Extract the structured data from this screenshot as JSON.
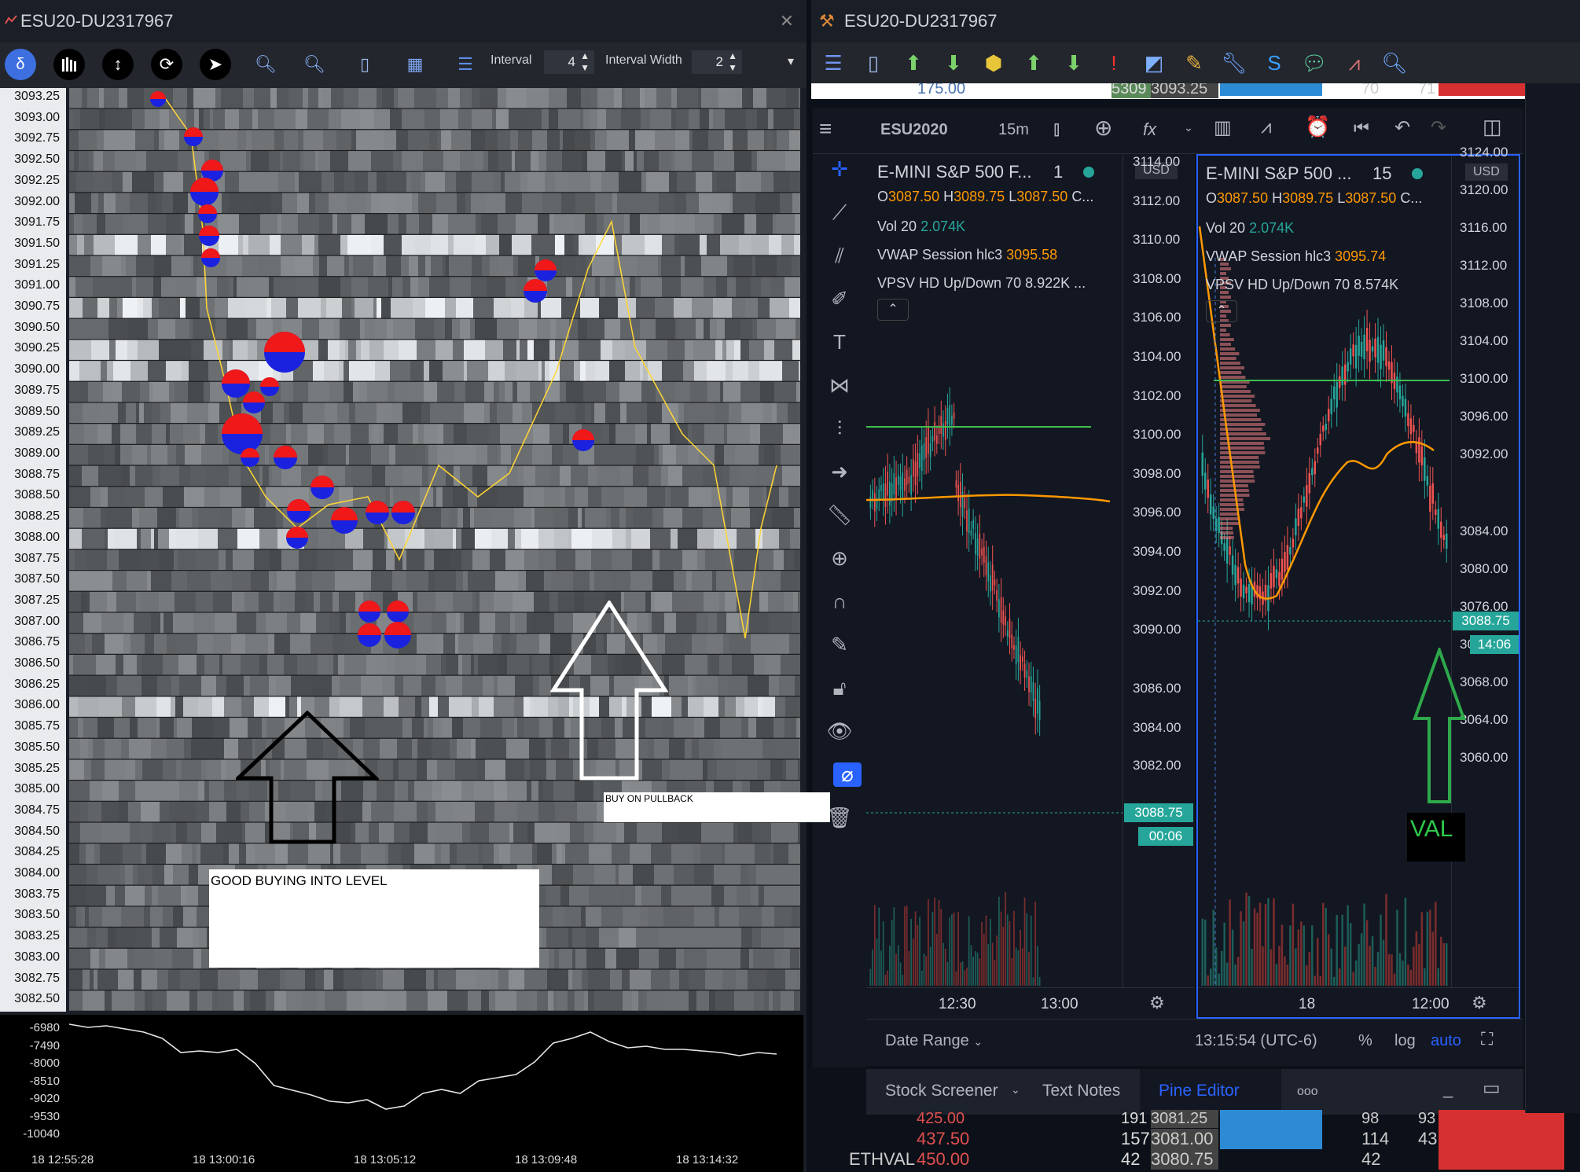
{
  "left_window": {
    "title": "ESU20-DU2317967",
    "close_glyph": "✕",
    "toolbar": {
      "interval_label": "Interval",
      "interval_value": "4",
      "interval_width_label": "Interval Width",
      "interval_width_value": "2",
      "overflow_glyph": "▾"
    },
    "price_ladder": [
      "3093.25",
      "3093.00",
      "3092.75",
      "3092.50",
      "3092.25",
      "3092.00",
      "3091.75",
      "3091.50",
      "3091.25",
      "3091.00",
      "3090.75",
      "3090.50",
      "3090.25",
      "3090.00",
      "3089.75",
      "3089.50",
      "3089.25",
      "3089.00",
      "3088.75",
      "3088.50",
      "3088.25",
      "3088.00",
      "3087.75",
      "3087.50",
      "3087.25",
      "3087.00",
      "3086.75",
      "3086.50",
      "3086.25",
      "3086.00",
      "3085.75",
      "3085.50",
      "3085.25",
      "3085.00",
      "3084.75",
      "3084.50",
      "3084.25",
      "3084.00",
      "3083.75",
      "3083.50",
      "3083.25",
      "3083.00",
      "3082.75",
      "3082.50"
    ],
    "annotations": {
      "good_buying": "GOOD BUYING INTO LEVEL",
      "buy_pullback": "BUY ON PULLBACK"
    },
    "delta_axis": [
      "-6980",
      "-7490",
      "-8000",
      "-8510",
      "-9020",
      "-9530",
      "-10040"
    ],
    "time_axis": [
      "18 12:55:28",
      "18 13:00:16",
      "18 13:05:12",
      "18 13:09:48",
      "18 13:14:32"
    ]
  },
  "right_window": {
    "title": "ESU20-DU2317967",
    "dom_top": {
      "price": "175.00",
      "vol": "5309",
      "level": "3093.25",
      "bid": "70",
      "ask": "71"
    },
    "tv_header": {
      "symbol": "ESU2020",
      "interval": "15m",
      "fx": "fx"
    },
    "pane1": {
      "name": "E-MINI S&P 500 F...",
      "interval": "1",
      "currency": "USD",
      "ohlc": {
        "o_label": "O",
        "o": "3087.50",
        "h_label": "H",
        "h": "3089.75",
        "l_label": "L",
        "l": "3087.50",
        "c_label": "C..."
      },
      "vol_label": "Vol 20",
      "vol_value": "2.074K",
      "vwap_label": "VWAP Session hlc3",
      "vwap_value": "3095.58",
      "vpsv_label": "VPSV HD Up/Down 70",
      "vpsv_value": "8.922K ...",
      "price_axis": [
        "3114.00",
        "3112.00",
        "3110.00",
        "3108.00",
        "3106.00",
        "3104.00",
        "3102.00",
        "3100.00",
        "3098.00",
        "3096.00",
        "3094.00",
        "3092.00",
        "3090.00",
        "3086.00",
        "3084.00",
        "3082.00"
      ],
      "last_price": "3088.75",
      "countdown": "00:06",
      "time_axis": [
        "12:30",
        "13:00"
      ]
    },
    "pane2": {
      "name": "E-MINI S&P 500 ...",
      "interval": "15",
      "currency": "USD",
      "ohlc": {
        "o_label": "O",
        "o": "3087.50",
        "h_label": "H",
        "h": "3089.75",
        "l_label": "L",
        "l": "3087.50",
        "c_label": "C..."
      },
      "vol_label": "Vol 20",
      "vol_value": "2.074K",
      "vwap_label": "VWAP Session hlc3",
      "vwap_value": "3095.74",
      "vpsv_label": "VPSV HD Up/Down 70",
      "vpsv_value": "8.574K",
      "price_axis": [
        "3124.00",
        "3120.00",
        "3116.00",
        "3112.00",
        "3108.00",
        "3104.00",
        "3100.00",
        "3096.00",
        "3092.00",
        "3088.75",
        "3084.00",
        "3080.00",
        "3076.00",
        "3072.00",
        "3068.00",
        "3064.00",
        "3060.00"
      ],
      "last_price": "3088.75",
      "countdown": "14:06",
      "time_axis": [
        "18",
        "12:00"
      ],
      "val_label": "VAL"
    },
    "bottom_bar": {
      "date_range": "Date Range",
      "clock": "13:15:54 (UTC-6)",
      "percent": "%",
      "log": "log",
      "auto": "auto"
    },
    "tabs": [
      "Stock Screener",
      "Text Notes",
      "Pine Editor",
      "ooo"
    ],
    "dom_bottom": {
      "row1": {
        "price": "425.00",
        "vol": "191",
        "level": "3081.25",
        "bid": "98",
        "ask": "93"
      },
      "row2": {
        "price": "437.50",
        "vol": "157",
        "level": "3081.00",
        "bid": "114",
        "ask": "43"
      },
      "row3": {
        "label": "ETHVAL",
        "price": "450.00",
        "vol": "42",
        "level": "3080.75",
        "bid": "42"
      }
    },
    "accent_colors": {
      "teal": "#26a69a",
      "red": "#ef5350",
      "orange": "#ff9800",
      "blue": "#2962ff"
    }
  }
}
